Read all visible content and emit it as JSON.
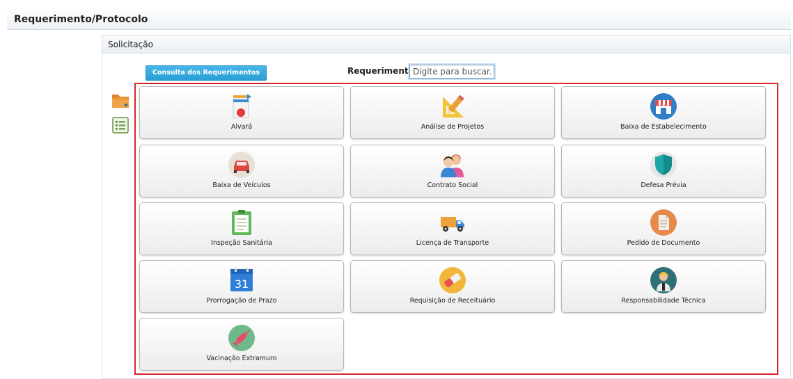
{
  "header": {
    "title": "Requerimento/Protocolo"
  },
  "panel": {
    "title": "Solicitação"
  },
  "toolbar": {
    "consulta_label": "Consulta dos Requerimentos"
  },
  "search": {
    "label": "Requerimento",
    "placeholder": "Digite para buscar..."
  },
  "side_icons": [
    "folder-icon",
    "list-icon"
  ],
  "tiles": [
    {
      "label": "Alvará",
      "icon": "document-seal-icon"
    },
    {
      "label": "Análise de Projetos",
      "icon": "pencil-ruler-icon"
    },
    {
      "label": "Baixa de Estabelecimento",
      "icon": "storefront-icon"
    },
    {
      "label": "Baixa de Veículos",
      "icon": "car-icon"
    },
    {
      "label": "Contrato Social",
      "icon": "people-icon"
    },
    {
      "label": "Defesa Prévia",
      "icon": "shield-icon"
    },
    {
      "label": "Inspeção Sanitária",
      "icon": "clipboard-icon"
    },
    {
      "label": "Licença de Transporte",
      "icon": "truck-icon"
    },
    {
      "label": "Pedido de Documento",
      "icon": "document-icon"
    },
    {
      "label": "Prorrogação de Prazo",
      "icon": "calendar-icon"
    },
    {
      "label": "Requisição de Receituário",
      "icon": "eraser-icon"
    },
    {
      "label": "Responsabilidade Técnica",
      "icon": "engineer-icon"
    },
    {
      "label": "Vacinação Extramuro",
      "icon": "syringe-icon"
    }
  ],
  "calendar_day": "31",
  "colors": {
    "accent_button": "#2a9fd6",
    "highlight_border": "#d9262a"
  }
}
